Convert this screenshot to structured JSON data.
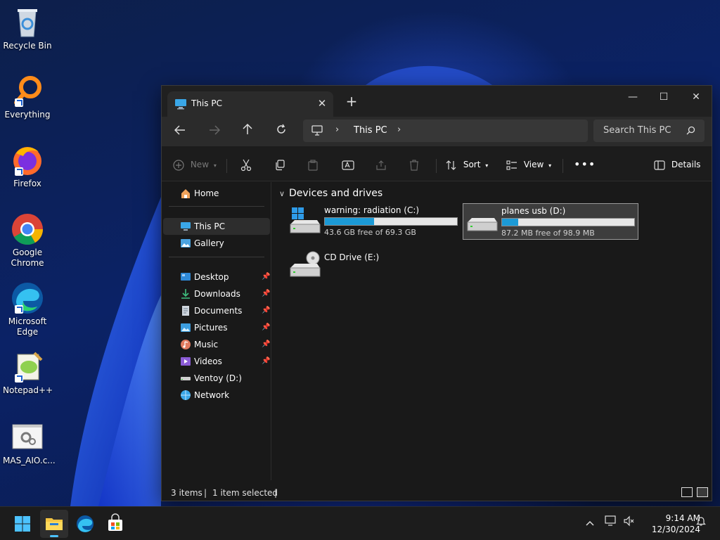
{
  "desktop": {
    "icons": [
      {
        "label": "Recycle Bin"
      },
      {
        "label": "Everything"
      },
      {
        "label": "Firefox"
      },
      {
        "label": "Google Chrome"
      },
      {
        "label": "Microsoft Edge"
      },
      {
        "label": "Notepad++"
      },
      {
        "label": "MAS_AIO.c..."
      }
    ]
  },
  "window": {
    "tab_title": "This PC",
    "address": {
      "crumb": "This PC"
    },
    "search": {
      "placeholder": "Search This PC"
    },
    "commands": {
      "new": "New",
      "sort": "Sort",
      "view": "View",
      "details": "Details"
    },
    "sidebar": {
      "home": "Home",
      "this_pc": "This PC",
      "gallery": "Gallery",
      "quick_access": [
        {
          "label": "Desktop"
        },
        {
          "label": "Downloads"
        },
        {
          "label": "Documents"
        },
        {
          "label": "Pictures"
        },
        {
          "label": "Music"
        },
        {
          "label": "Videos"
        }
      ],
      "ventoy": "Ventoy (D:)",
      "network": "Network"
    },
    "content": {
      "group_title": "Devices and drives",
      "drives": [
        {
          "name": "warning: radiation (C:)",
          "free_text": "43.6 GB free of 69.3 GB",
          "used_fraction": 0.37
        },
        {
          "name": "planes usb (D:)",
          "free_text": "87.2 MB free of 98.9 MB",
          "used_fraction": 0.12
        },
        {
          "name": "CD Drive (E:)"
        }
      ]
    },
    "status": {
      "items": "3 items",
      "selected": "1 item selected",
      "separator": "|"
    }
  },
  "taskbar": {
    "time": "9:14 AM",
    "date": "12/30/2024"
  },
  "colors": {
    "accent": "#4cc2ff",
    "drive_bar": "#1c9ad6"
  }
}
